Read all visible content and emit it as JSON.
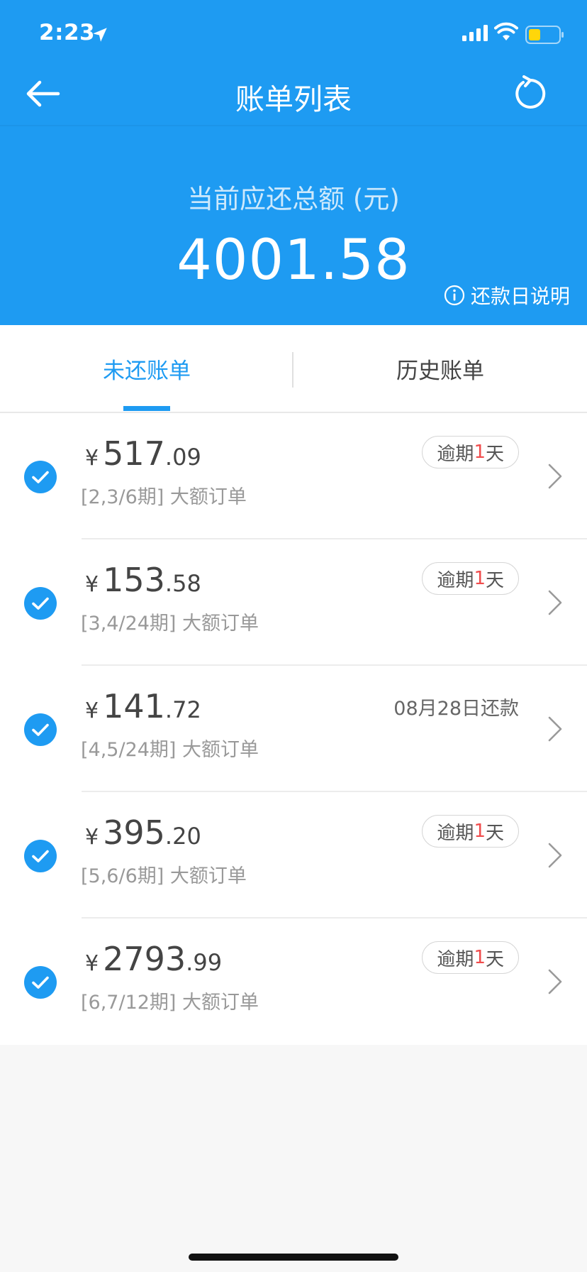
{
  "status_bar": {
    "time": "2:23"
  },
  "nav": {
    "title": "账单列表"
  },
  "summary": {
    "label": "当前应还总额 (元)",
    "amount": "4001.58",
    "repay_info": "还款日说明"
  },
  "tabs": [
    {
      "label": "未还账单",
      "active": true
    },
    {
      "label": "历史账单",
      "active": false
    }
  ],
  "bills": [
    {
      "currency": "¥",
      "integer": "517",
      "decimal": ".09",
      "term": "[2,3/6期] 大额订单",
      "status_type": "overdue",
      "status_prefix": "逾期",
      "status_num": "1",
      "status_suffix": "天"
    },
    {
      "currency": "¥",
      "integer": "153",
      "decimal": ".58",
      "term": "[3,4/24期] 大额订单",
      "status_type": "overdue",
      "status_prefix": "逾期",
      "status_num": "1",
      "status_suffix": "天"
    },
    {
      "currency": "¥",
      "integer": "141",
      "decimal": ".72",
      "term": "[4,5/24期] 大额订单",
      "status_type": "due",
      "due_text": "08月28日还款"
    },
    {
      "currency": "¥",
      "integer": "395",
      "decimal": ".20",
      "term": "[5,6/6期] 大额订单",
      "status_type": "overdue",
      "status_prefix": "逾期",
      "status_num": "1",
      "status_suffix": "天"
    },
    {
      "currency": "¥",
      "integer": "2793",
      "decimal": ".99",
      "term": "[6,7/12期] 大额订单",
      "status_type": "overdue",
      "status_prefix": "逾期",
      "status_num": "1",
      "status_suffix": "天"
    }
  ],
  "colors": {
    "primary": "#1e9bf2",
    "overdue_number": "#f04c4c",
    "page_background": "#f7f7f7"
  }
}
